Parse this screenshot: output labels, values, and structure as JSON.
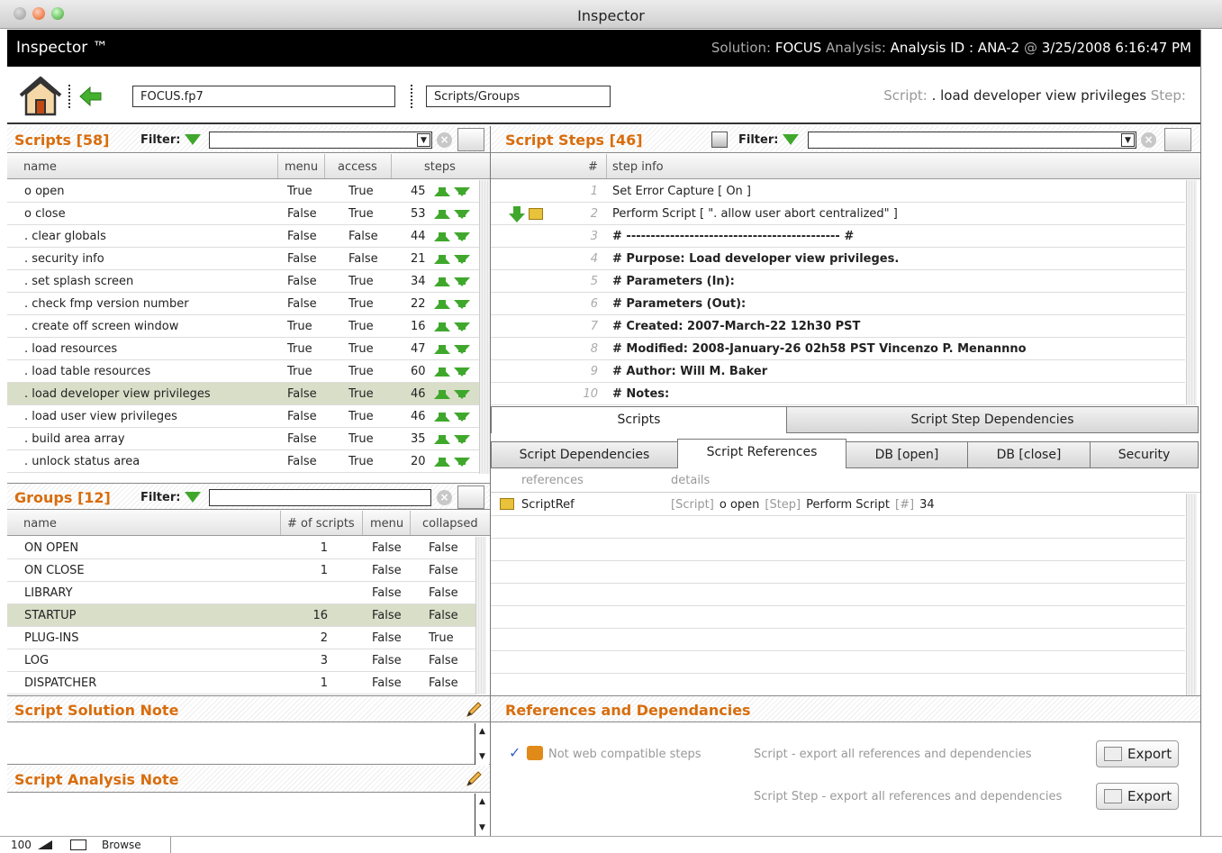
{
  "window": {
    "title": "Inspector"
  },
  "header": {
    "app_title": "Inspector ™",
    "solution_label": "Solution: ",
    "solution_value": "FOCUS",
    "analysis_label": " Analysis: ",
    "analysis_value": "Analysis ID : ANA-2",
    "at_label": " @ ",
    "datetime": "3/25/2008 6:16:47 PM"
  },
  "nav": {
    "file_field": "FOCUS.fp7",
    "layout_field": "Scripts/Groups",
    "script_label": "Script: ",
    "script_value": ". load developer view privileges",
    "step_label": " Step:"
  },
  "scripts_panel": {
    "title": "Scripts [58]",
    "filter_label": "Filter:",
    "filter_value": "",
    "columns": [
      "name",
      "menu",
      "access",
      "steps"
    ],
    "rows": [
      {
        "name": "o open",
        "menu": "True",
        "access": "True",
        "steps": "45"
      },
      {
        "name": "o close",
        "menu": "False",
        "access": "True",
        "steps": "53"
      },
      {
        "name": ". clear globals",
        "menu": "False",
        "access": "False",
        "steps": "44"
      },
      {
        "name": ". security info",
        "menu": "False",
        "access": "False",
        "steps": "21"
      },
      {
        "name": ". set splash screen",
        "menu": "False",
        "access": "True",
        "steps": "34"
      },
      {
        "name": ". check fmp version number",
        "menu": "False",
        "access": "True",
        "steps": "22"
      },
      {
        "name": ". create off screen window",
        "menu": "True",
        "access": "True",
        "steps": "16"
      },
      {
        "name": ". load resources",
        "menu": "True",
        "access": "True",
        "steps": "47"
      },
      {
        "name": ". load table resources",
        "menu": "True",
        "access": "True",
        "steps": "60"
      },
      {
        "name": ". load developer view privileges",
        "menu": "False",
        "access": "True",
        "steps": "46"
      },
      {
        "name": ". load user view privileges",
        "menu": "False",
        "access": "True",
        "steps": "46"
      },
      {
        "name": ". build area array",
        "menu": "False",
        "access": "True",
        "steps": "35"
      },
      {
        "name": ". unlock status area",
        "menu": "False",
        "access": "True",
        "steps": "20"
      }
    ]
  },
  "groups_panel": {
    "title": "Groups [12]",
    "filter_label": "Filter:",
    "filter_value": "",
    "columns": [
      "name",
      "# of scripts",
      "menu",
      "collapsed"
    ],
    "rows": [
      {
        "name": "ON OPEN",
        "count": "1",
        "menu": "False",
        "collapsed": "False"
      },
      {
        "name": "ON  CLOSE",
        "count": "1",
        "menu": "False",
        "collapsed": "False"
      },
      {
        "name": "LIBRARY",
        "count": "",
        "menu": "False",
        "collapsed": "False"
      },
      {
        "name": "STARTUP",
        "count": "16",
        "menu": "False",
        "collapsed": "False"
      },
      {
        "name": "PLUG-INS",
        "count": "2",
        "menu": "False",
        "collapsed": "True"
      },
      {
        "name": "LOG",
        "count": "3",
        "menu": "False",
        "collapsed": "False"
      },
      {
        "name": "DISPATCHER",
        "count": "1",
        "menu": "False",
        "collapsed": "False"
      }
    ]
  },
  "steps_panel": {
    "title": "Script Steps [46]",
    "filter_label": "Filter:",
    "filter_value": "",
    "columns": [
      "#",
      "step info"
    ],
    "rows": [
      {
        "num": "1",
        "info": "Set Error Capture [ On ]"
      },
      {
        "num": "2",
        "info": "Perform Script [ \". allow user abort centralized\" ]"
      },
      {
        "num": "3",
        "info": "# -------------------------------------------- #"
      },
      {
        "num": "4",
        "info": "# Purpose: Load developer view privileges."
      },
      {
        "num": "5",
        "info": "# Parameters (In):"
      },
      {
        "num": "6",
        "info": "# Parameters (Out):"
      },
      {
        "num": "7",
        "info": "# Created: 2007-March-22 12h30 PST"
      },
      {
        "num": "8",
        "info": "# Modified: 2008-January-26 02h58 PST Vincenzo P. Menannno"
      },
      {
        "num": "9",
        "info": "# Author: Will M. Baker"
      },
      {
        "num": "10",
        "info": "# Notes:"
      }
    ]
  },
  "tabs": {
    "row1": [
      "Scripts",
      "Script Step Dependencies"
    ],
    "row2": [
      "Script Dependencies",
      "Script References",
      "DB [open]",
      "DB [close]",
      "Security"
    ]
  },
  "references": {
    "columns": [
      "references",
      "details"
    ],
    "rows": [
      {
        "name": "ScriptRef",
        "tag1": "[Script]",
        "val1": "o open",
        "tag2": "[Step]",
        "val2": "Perform Script",
        "tag3": "[#]",
        "val3": "34"
      }
    ]
  },
  "notes": {
    "solution_title": "Script Solution Note",
    "analysis_title": "Script Analysis Note"
  },
  "refdep": {
    "title": "References and Dependancies",
    "web_label": "Not web compatible steps",
    "export1_text": "Script - export all references and dependencies",
    "export2_text": "Script Step - export all references and dependencies",
    "export_label": "Export"
  },
  "status": {
    "zoom": "100",
    "mode": "Browse"
  },
  "colors": {
    "accent": "#d86d0d",
    "selected_row": "#d9dec8",
    "arrow_green": "#3fa82c"
  }
}
